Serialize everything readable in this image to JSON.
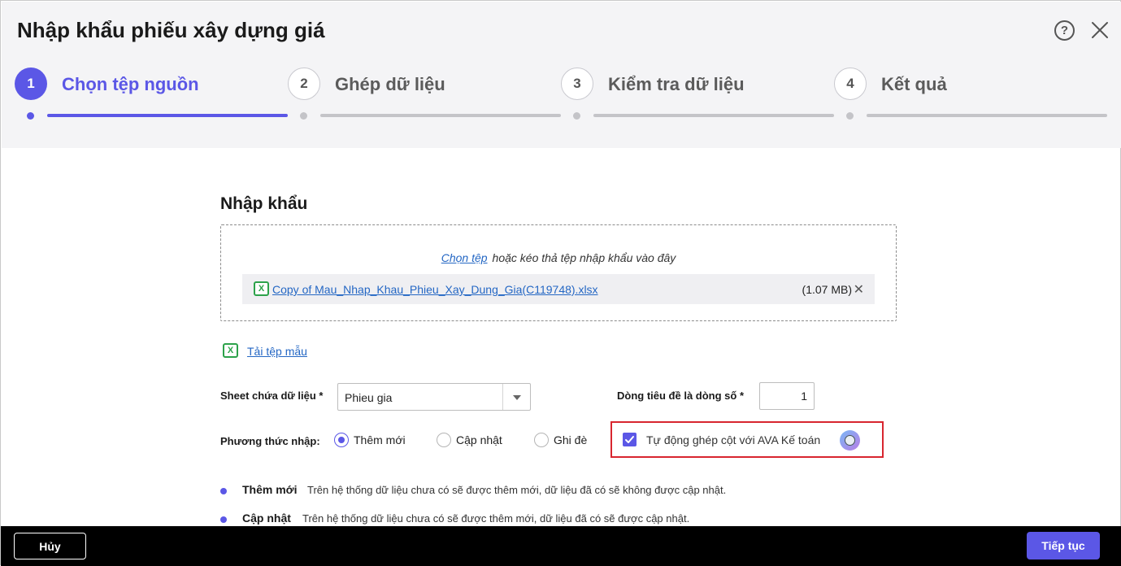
{
  "dialog": {
    "title": "Nhập khẩu phiếu xây dựng giá",
    "help_symbol": "?"
  },
  "stepper": {
    "steps": [
      {
        "number": "1",
        "label": "Chọn tệp nguồn",
        "active": true
      },
      {
        "number": "2",
        "label": "Ghép dữ liệu",
        "active": false
      },
      {
        "number": "3",
        "label": "Kiểm tra dữ liệu",
        "active": false
      },
      {
        "number": "4",
        "label": "Kết quả",
        "active": false
      }
    ]
  },
  "import": {
    "section_title": "Nhập khẩu",
    "choose_file_link": "Chọn tệp",
    "drop_hint": "hoặc kéo thả tệp nhập khẩu vào đây",
    "file": {
      "name": "Copy of Mau_Nhap_Khau_Phieu_Xay_Dung_Gia(C119748).xlsx",
      "size": "(1.07 MB)",
      "remove_symbol": "✕",
      "icon": "excel-file-icon",
      "icon_letter": "X"
    },
    "template_link": "Tải tệp mẫu"
  },
  "form": {
    "sheet_label": "Sheet chứa dữ liệu *",
    "sheet_value": "Phieu gia",
    "header_row_label": "Dòng tiêu đề là dòng số *",
    "header_row_value": "1",
    "method_label": "Phương thức nhập:",
    "methods": [
      {
        "label": "Thêm mới",
        "checked": true
      },
      {
        "label": "Cập nhật",
        "checked": false
      },
      {
        "label": "Ghi đè",
        "checked": false
      }
    ],
    "auto_map_label": "Tự động ghép cột với AVA Kế toán",
    "auto_map_checked": true
  },
  "notes": [
    {
      "title": "Thêm mới",
      "text": "Trên hệ thống dữ liệu chưa có sẽ được thêm mới, dữ liệu đã có sẽ không được cập nhật."
    },
    {
      "title": "Cập nhật",
      "text": "Trên hệ thống dữ liệu chưa có sẽ được thêm mới, dữ liệu đã có sẽ được cập nhật."
    }
  ],
  "footer": {
    "cancel_label": "Hủy",
    "next_label": "Tiếp tục"
  },
  "colors": {
    "accent": "#5b57e6",
    "link": "#2467c4",
    "highlight_border": "#d8262f",
    "excel_green": "#2ca24a",
    "footer_bg": "#000000"
  }
}
